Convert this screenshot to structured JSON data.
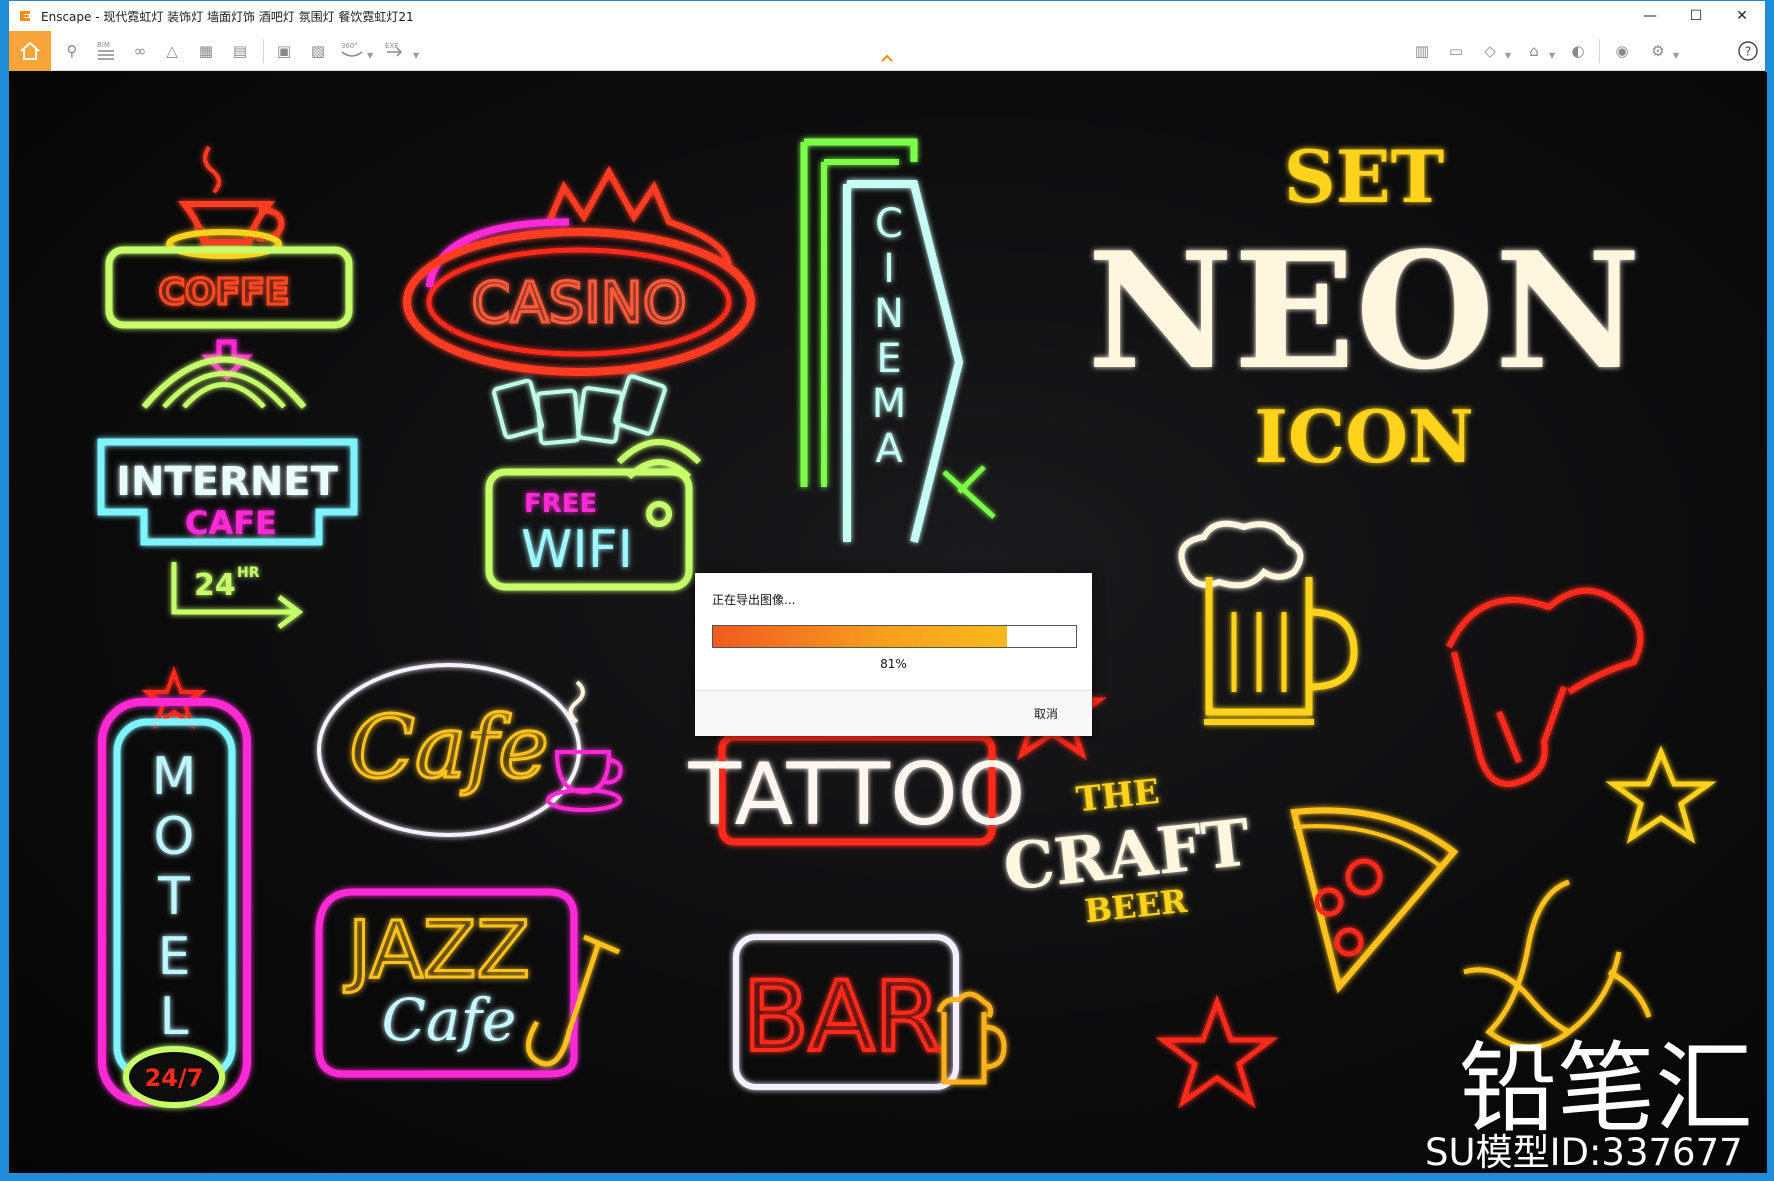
{
  "window": {
    "title": "Enscape - 现代霓虹灯 装饰灯 墙面灯饰 酒吧灯 氛围灯 餐饮霓虹灯21",
    "controls": {
      "minimize": "—",
      "maximize": "☐",
      "close": "✕"
    }
  },
  "toolbar": {
    "bim_label": "BIM",
    "pano_label": "360°",
    "exe_label": "EXE",
    "help_label": "?"
  },
  "scene": {
    "signs": {
      "coffe": "COFFE",
      "casino": "CASINO",
      "cinema": [
        "C",
        "I",
        "N",
        "E",
        "M",
        "A"
      ],
      "internet": "INTERNET",
      "cafe_small": "CAFE",
      "hours": "24",
      "hours_suffix": "HR",
      "free": "FREE",
      "wifi": "WIFI",
      "set": "SET",
      "neon": "NEON",
      "icon": "ICON",
      "cafe_script": "Cafe",
      "tattoo": "TATTOO",
      "motel": [
        "M",
        "O",
        "T",
        "E",
        "L"
      ],
      "motel_hours": "24/7",
      "jazz": "JAZZ",
      "jazz_cafe": "Cafe",
      "bar": "BAR",
      "the": "THE",
      "craft": "CRAFT",
      "beer": "BEER"
    },
    "colors": {
      "green": "#7dff4a",
      "yellow": "#ffd21e",
      "red": "#ff3b22",
      "pink": "#ff2bd6",
      "cyan": "#7ff3ff",
      "white": "#fff6e0",
      "orange": "#ffb21a"
    }
  },
  "export_dialog": {
    "message": "正在导出图像...",
    "progress": 0.81,
    "percent_label": "81%",
    "cancel_label": "取消"
  },
  "watermark": {
    "brand": "铅笔汇",
    "model_id": "SU模型ID:337677"
  }
}
